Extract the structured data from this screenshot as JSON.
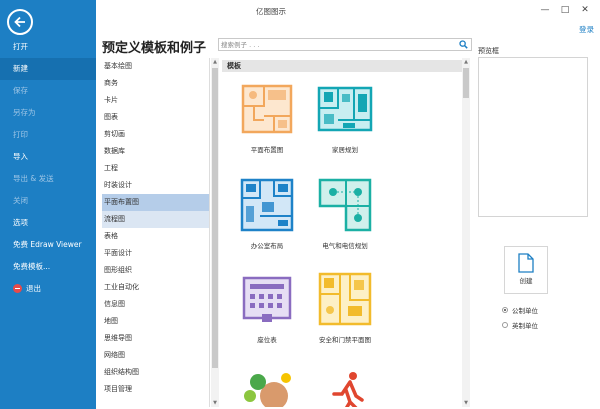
{
  "window": {
    "title": "亿图图示",
    "login": "登录",
    "minimize": "—",
    "maximize": "□",
    "close": "✕"
  },
  "sidebar": {
    "items": [
      {
        "label": "打开"
      },
      {
        "label": "新建"
      },
      {
        "label": "保存"
      },
      {
        "label": "另存为"
      },
      {
        "label": "打印"
      },
      {
        "label": "导入"
      },
      {
        "label": "导出 & 发送"
      },
      {
        "label": "关闭"
      },
      {
        "label": "选项"
      },
      {
        "label": "免费 Edraw Viewer"
      },
      {
        "label": "免费模板..."
      },
      {
        "label": "退出"
      }
    ]
  },
  "main": {
    "title": "预定义模板和例子",
    "search_placeholder": "搜索例子 . . .",
    "categories": [
      "基本绘图",
      "商务",
      "卡片",
      "图表",
      "剪切画",
      "数据库",
      "工程",
      "时装设计",
      "平面布置图",
      "流程图",
      "表格",
      "平面设计",
      "图形组织",
      "工业自动化",
      "信息图",
      "地图",
      "思维导图",
      "网络图",
      "组织结构图",
      "项目管理"
    ],
    "templates_header": "模板",
    "templates": [
      {
        "label": "平面布置图"
      },
      {
        "label": "家居规划"
      },
      {
        "label": "办公室布局"
      },
      {
        "label": "电气和电信规划"
      },
      {
        "label": "座位表"
      },
      {
        "label": "安全和门禁平面图"
      }
    ]
  },
  "preview": {
    "title": "预览框",
    "create_label": "创建",
    "units": [
      "公制单位",
      "英制单位"
    ]
  },
  "colors": {
    "sidebar": "#1d7fc4",
    "selected_category": "#b5cde9",
    "floorplan": "#f2a75c",
    "home": "#13a6b4",
    "office": "#1e82c8",
    "electrical": "#1bb0a4",
    "seating": "#8a6cc0",
    "security": "#f2bb2c"
  }
}
